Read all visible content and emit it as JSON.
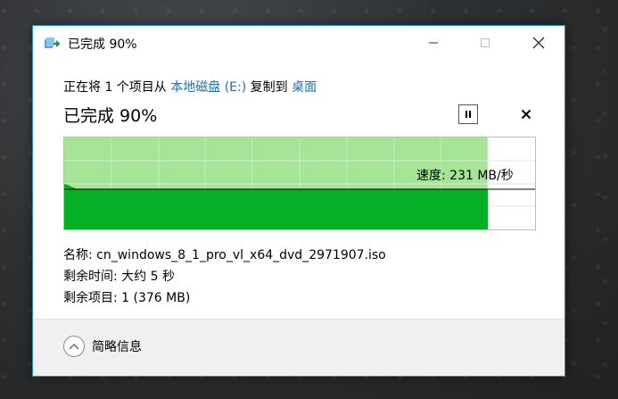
{
  "window": {
    "title": "已完成 90%",
    "icon": "copy-arrow-icon",
    "minimize_icon": "minimize-icon",
    "maximize_icon": "maximize-icon",
    "close_icon": "close-icon"
  },
  "copy_line": {
    "prefix": "正在将 1 个项目从 ",
    "source": "本地磁盘 (E:)",
    "middle": " 复制到 ",
    "destination": "桌面"
  },
  "status": {
    "title": "已完成 90%",
    "progress_percent": 90,
    "pause_icon": "pause-icon",
    "cancel_icon": "cancel-icon"
  },
  "graph": {
    "speed_label": "速度: 231 MB/秒",
    "speed_mb_per_s": 231,
    "colors": {
      "completed_bg": "#a6e497",
      "speed_fill": "#06b025",
      "grid": "#c9e9c2",
      "speed_line": "#000000"
    }
  },
  "details": {
    "name": "名称: cn_windows_8_1_pro_vl_x64_dvd_2971907.iso",
    "time_remaining": "剩余时间: 大约 5 秒",
    "items_remaining": "剩余项目: 1 (376 MB)"
  },
  "footer": {
    "less_details_label": "简略信息",
    "less_details_icon": "chevron-up-icon"
  },
  "colors": {
    "accent_border": "#1d8fd6",
    "link": "#1a6fb5"
  }
}
